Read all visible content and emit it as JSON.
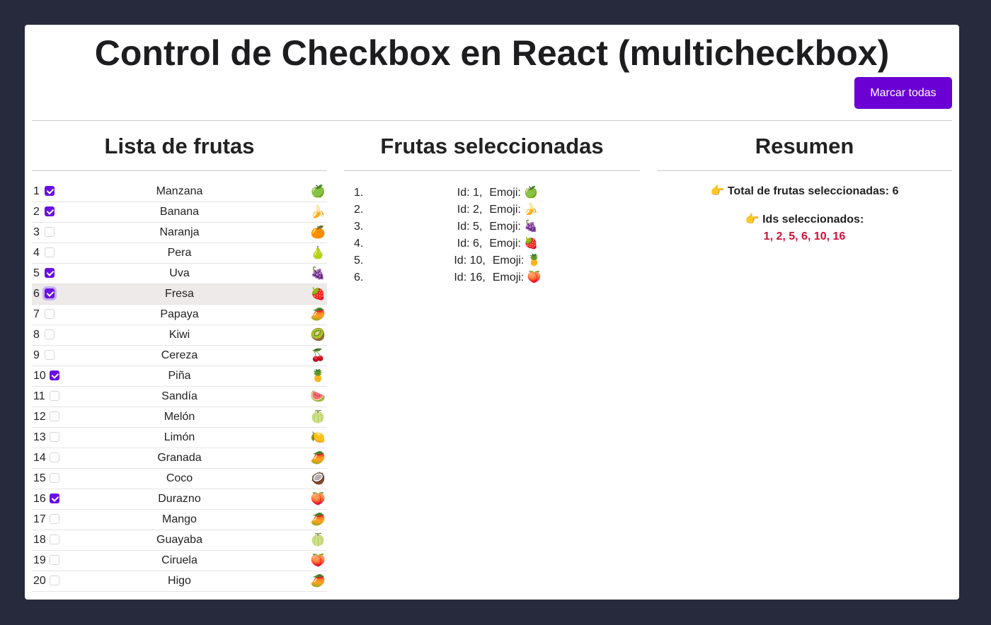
{
  "title": "Control de Checkbox en React (multicheckbox)",
  "mark_all_label": "Marcar todas",
  "colors": {
    "background": "#262a3c",
    "accent": "#6a00d4",
    "ids_color": "#d0103a"
  },
  "list": {
    "title": "Lista de frutas",
    "items": [
      {
        "id": "1",
        "name": "Manzana",
        "emoji": "🍏",
        "checked": true
      },
      {
        "id": "2",
        "name": "Banana",
        "emoji": "🍌",
        "checked": true
      },
      {
        "id": "3",
        "name": "Naranja",
        "emoji": "🍊",
        "checked": false
      },
      {
        "id": "4",
        "name": "Pera",
        "emoji": "🍐",
        "checked": false
      },
      {
        "id": "5",
        "name": "Uva",
        "emoji": "🍇",
        "checked": true
      },
      {
        "id": "6",
        "name": "Fresa",
        "emoji": "🍓",
        "checked": true,
        "focused": true
      },
      {
        "id": "7",
        "name": "Papaya",
        "emoji": "🥭",
        "checked": false
      },
      {
        "id": "8",
        "name": "Kiwi",
        "emoji": "🥝",
        "checked": false
      },
      {
        "id": "9",
        "name": "Cereza",
        "emoji": "🍒",
        "checked": false
      },
      {
        "id": "10",
        "name": "Piña",
        "emoji": "🍍",
        "checked": true
      },
      {
        "id": "11",
        "name": "Sandía",
        "emoji": "🍉",
        "checked": false
      },
      {
        "id": "12",
        "name": "Melón",
        "emoji": "🍈",
        "checked": false
      },
      {
        "id": "13",
        "name": "Limón",
        "emoji": "🍋",
        "checked": false
      },
      {
        "id": "14",
        "name": "Granada",
        "emoji": "🥭",
        "checked": false
      },
      {
        "id": "15",
        "name": "Coco",
        "emoji": "🥥",
        "checked": false
      },
      {
        "id": "16",
        "name": "Durazno",
        "emoji": "🍑",
        "checked": true
      },
      {
        "id": "17",
        "name": "Mango",
        "emoji": "🥭",
        "checked": false
      },
      {
        "id": "18",
        "name": "Guayaba",
        "emoji": "🍈",
        "checked": false
      },
      {
        "id": "19",
        "name": "Ciruela",
        "emoji": "🍑",
        "checked": false
      },
      {
        "id": "20",
        "name": "Higo",
        "emoji": "🥭",
        "checked": false
      }
    ]
  },
  "selected": {
    "title": "Frutas seleccionadas",
    "items": [
      {
        "num": "1.",
        "id_text": "Id: 1,",
        "emoji_text": "Emoji: 🍏"
      },
      {
        "num": "2.",
        "id_text": "Id: 2,",
        "emoji_text": "Emoji: 🍌"
      },
      {
        "num": "3.",
        "id_text": "Id: 5,",
        "emoji_text": "Emoji: 🍇"
      },
      {
        "num": "4.",
        "id_text": "Id: 6,",
        "emoji_text": "Emoji: 🍓"
      },
      {
        "num": "5.",
        "id_text": "Id: 10,",
        "emoji_text": "Emoji: 🍍"
      },
      {
        "num": "6.",
        "id_text": "Id: 16,",
        "emoji_text": "Emoji: 🍑"
      }
    ]
  },
  "summary": {
    "title": "Resumen",
    "total_label": "👉 Total de frutas seleccionadas: 6",
    "ids_label": "👉 Ids seleccionados:",
    "ids_value": "1, 2, 5, 6, 10, 16"
  }
}
